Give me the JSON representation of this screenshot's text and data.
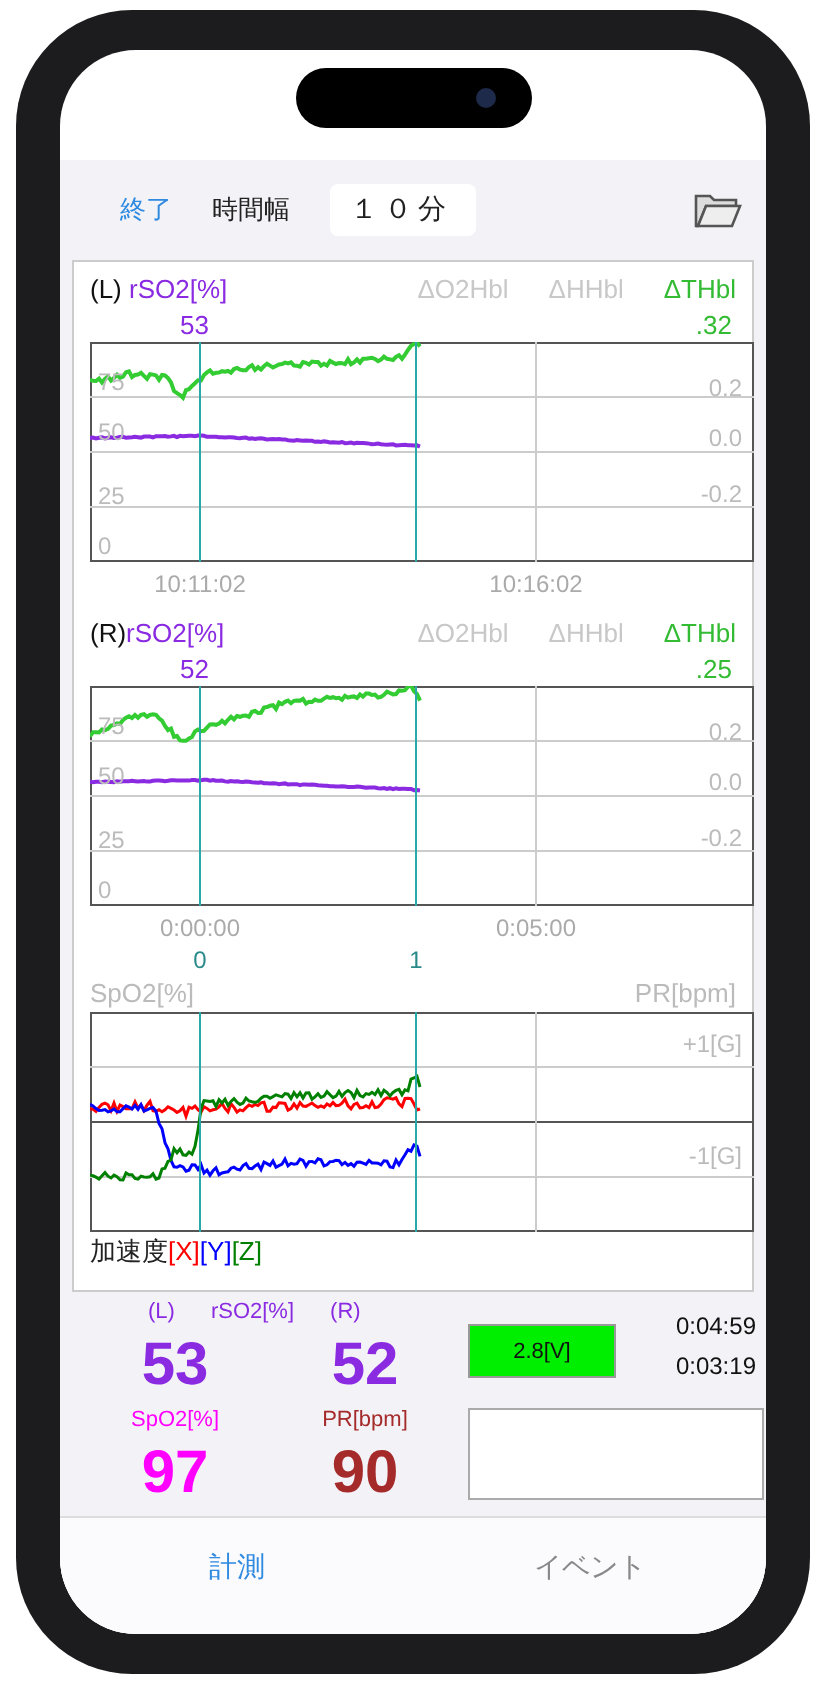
{
  "toolbar": {
    "end_button": "終了",
    "range_label": "時間幅",
    "range_value": "１０分"
  },
  "panels": [
    {
      "kind": "nirs",
      "side_label": "(L) ",
      "title": "rSO2[%]",
      "columns": [
        {
          "label": "ΔO2Hbl",
          "selected": false
        },
        {
          "label": "ΔHHbl",
          "selected": false
        },
        {
          "label": "ΔTHbl",
          "selected": true
        }
      ],
      "value": "53",
      "delta_value": ".32",
      "left_ticks": [
        "75",
        "50",
        "25",
        "0"
      ],
      "right_ticks": [
        "0.2",
        "0.0",
        "-0.2"
      ],
      "time_labels": [
        "10:11:02",
        "10:16:02"
      ]
    },
    {
      "kind": "nirs",
      "side_label": "(R)",
      "title": "rSO2[%]",
      "columns": [
        {
          "label": "ΔO2Hbl",
          "selected": false
        },
        {
          "label": "ΔHHbl",
          "selected": false
        },
        {
          "label": "ΔTHbl",
          "selected": true
        }
      ],
      "value": "52",
      "delta_value": ".25",
      "left_ticks": [
        "75",
        "50",
        "25",
        "0"
      ],
      "right_ticks": [
        "0.2",
        "0.0",
        "-0.2"
      ],
      "time_labels": [
        "0:00:00",
        "0:05:00"
      ],
      "marker_labels": [
        "0",
        "1"
      ]
    },
    {
      "kind": "accel",
      "left_title": "SpO2[%]",
      "right_title": "PR[bpm]",
      "right_ticks": [
        "+1[G]",
        "-1[G]"
      ],
      "legend_label": "加速度",
      "legend": [
        {
          "text": "[X]",
          "color": "#ff0000"
        },
        {
          "text": "[Y]",
          "color": "#0000ff"
        },
        {
          "text": "[Z]",
          "color": "#008000"
        }
      ]
    }
  ],
  "readings": {
    "left_label": "(L)",
    "rso2_label": "rSO2[%]",
    "right_label": "(R)",
    "left_value": "53",
    "right_value": "52",
    "spo2_label": "SpO2[%]",
    "spo2_value": "97",
    "pr_label": "PR[bpm]",
    "pr_value": "90",
    "battery": "2.8[V]",
    "times": [
      "0:04:59",
      "0:03:19"
    ]
  },
  "tabs": [
    {
      "label": "計測",
      "selected": true
    },
    {
      "label": "イベント",
      "selected": false
    }
  ]
}
